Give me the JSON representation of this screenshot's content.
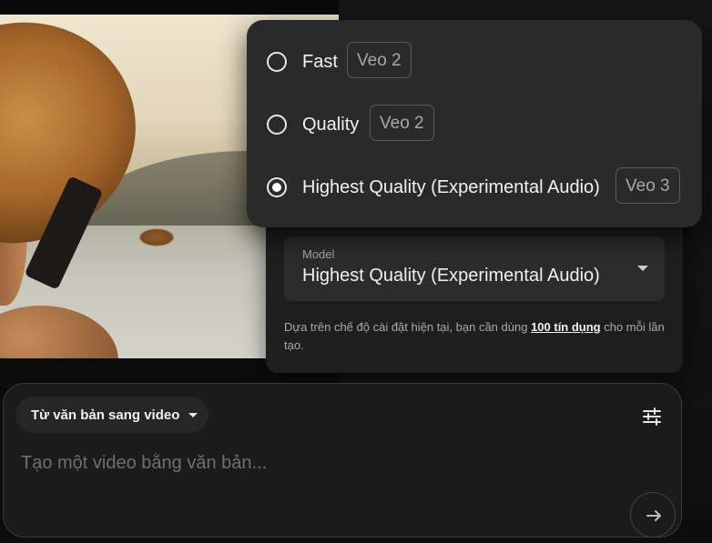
{
  "model_menu": {
    "options": [
      {
        "label": "Fast",
        "tag": "Veo 2",
        "selected": false
      },
      {
        "label": "Quality",
        "tag": "Veo 2",
        "selected": false
      },
      {
        "label": "Highest Quality (Experimental Audio)",
        "tag": "Veo 3",
        "selected": true
      }
    ]
  },
  "settings": {
    "model_label": "Model",
    "model_value": "Highest Quality (Experimental Audio)",
    "credit_prefix": "Dựa trên chế độ cài đặt hiện tại, bạn cần dùng ",
    "credit_link": "100 tín dụng",
    "credit_suffix": " cho mỗi lần tạo."
  },
  "prompt": {
    "mode_label": "Từ văn bản sang video",
    "placeholder": "Tạo một video bằng văn bản..."
  },
  "icons": {
    "tune": "tune-icon",
    "send": "arrow-right-icon",
    "caret": "chevron-down-icon"
  },
  "colors": {
    "background": "#0c0c0c",
    "panel": "#1e1e1e",
    "menu": "#2a2a2a",
    "text": "#f0f0f0",
    "muted": "#a8a8a8"
  }
}
